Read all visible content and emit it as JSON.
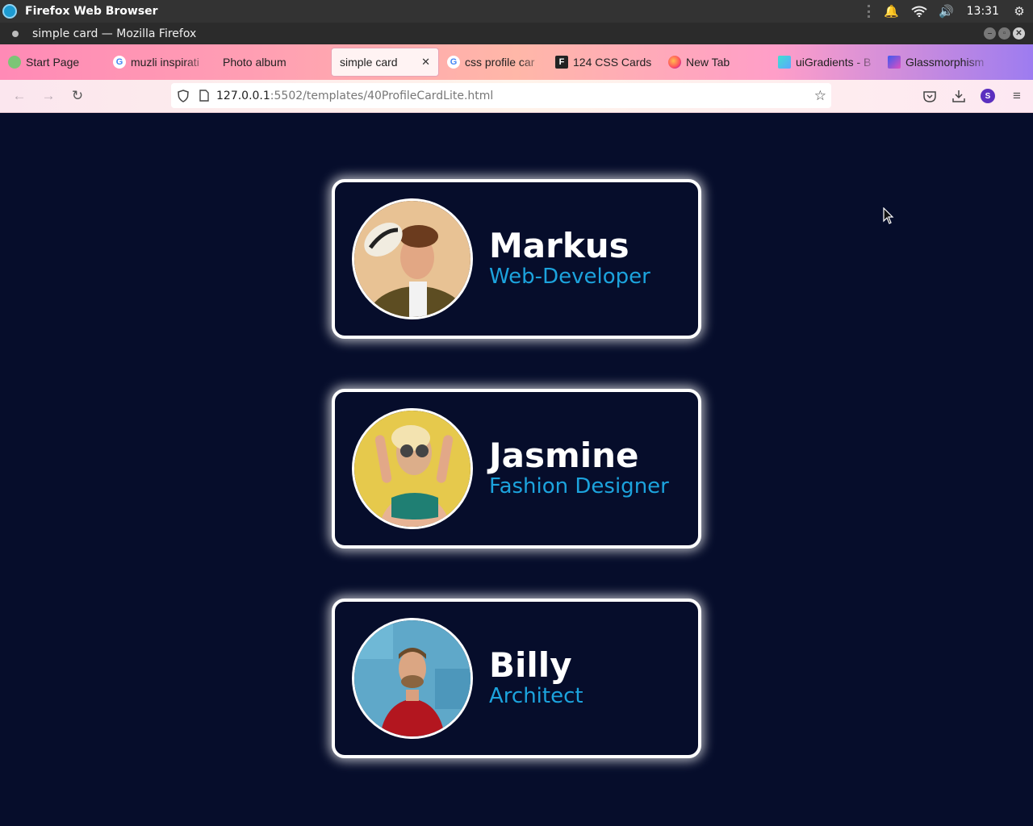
{
  "os": {
    "app_title": "Firefox Web Browser",
    "clock": "13:31"
  },
  "window": {
    "title": "simple card — Mozilla Firefox"
  },
  "tabs": [
    {
      "label": "Start Page",
      "icon": "puzzle-icon"
    },
    {
      "label": "muzli inspirati",
      "icon": "google-icon"
    },
    {
      "label": "Photo album",
      "icon": "none"
    },
    {
      "label": "simple card",
      "icon": "none",
      "active": true
    },
    {
      "label": "css profile car",
      "icon": "google-icon"
    },
    {
      "label": "124 CSS Cards",
      "icon": "freefrontend-icon"
    },
    {
      "label": "New Tab",
      "icon": "firefox-icon"
    },
    {
      "label": "uiGradients - B",
      "icon": "gradient-icon"
    },
    {
      "label": "Glassmorphism",
      "icon": "glass-icon"
    }
  ],
  "nav": {
    "url_host": "127.0.0.1",
    "url_path": ":5502/templates/40ProfileCardLite.html"
  },
  "profiles": [
    {
      "name": "Markus",
      "role": "Web-Developer"
    },
    {
      "name": "Jasmine",
      "role": "Fashion Designer"
    },
    {
      "name": "Billy",
      "role": "Architect"
    }
  ],
  "colors": {
    "background": "#060d2b",
    "role_text": "#1ca3dd",
    "card_border": "#ffffff"
  }
}
